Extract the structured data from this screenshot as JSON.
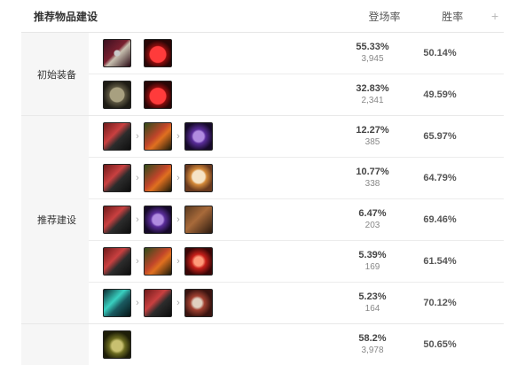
{
  "header": {
    "title": "推荐物品建设",
    "col_pick": "登场率",
    "col_win": "胜率",
    "add_icon": "plus-icon"
  },
  "sections": [
    {
      "label": "初始装备",
      "rows": [
        {
          "items": [
            "long-sword-icon",
            "health-potion-icon"
          ],
          "pick_rate": "55.33%",
          "count": "3,945",
          "win_rate": "50.14%"
        },
        {
          "items": [
            "dorans-shield-icon",
            "health-potion-icon"
          ],
          "pick_rate": "32.83%",
          "count": "2,341",
          "win_rate": "49.59%"
        }
      ]
    },
    {
      "label": "推荐建设",
      "rows": [
        {
          "items": [
            "black-cleaver-icon",
            "sterak-axe-icon",
            "armor-item-icon"
          ],
          "pick_rate": "12.27%",
          "count": "385",
          "win_rate": "65.97%"
        },
        {
          "items": [
            "black-cleaver-icon",
            "sterak-axe-icon",
            "guardian-angel-icon"
          ],
          "pick_rate": "10.77%",
          "count": "338",
          "win_rate": "64.79%"
        },
        {
          "items": [
            "black-cleaver-icon",
            "armor-item-icon",
            "sterak-gauntlet-icon"
          ],
          "pick_rate": "6.47%",
          "count": "203",
          "win_rate": "69.46%"
        },
        {
          "items": [
            "black-cleaver-icon",
            "sterak-axe-icon",
            "blood-item-icon"
          ],
          "pick_rate": "5.39%",
          "count": "169",
          "win_rate": "61.54%"
        },
        {
          "items": [
            "cyan-blade-icon",
            "black-cleaver-icon",
            "claw-item-icon"
          ],
          "pick_rate": "5.23%",
          "count": "164",
          "win_rate": "70.12%"
        }
      ]
    },
    {
      "label": "",
      "rows": [
        {
          "items": [
            "boots-icon"
          ],
          "pick_rate": "58.2%",
          "count": "3,978",
          "win_rate": "50.65%"
        }
      ]
    }
  ]
}
